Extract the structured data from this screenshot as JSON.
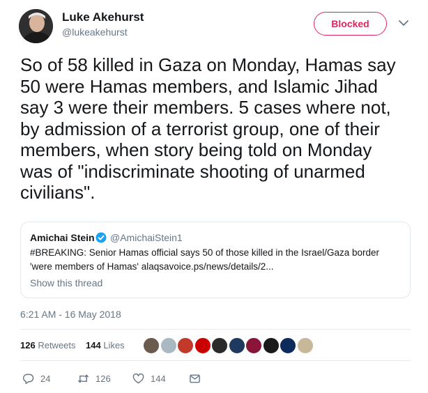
{
  "author": {
    "name": "Luke Akehurst",
    "handle": "@lukeakehurst"
  },
  "header": {
    "blocked_label": "Blocked"
  },
  "tweet": {
    "text": "So of 58 killed in Gaza on Monday, Hamas say\n50 were Hamas members, and Islamic Jihad\nsay 3 were their members. 5 cases where not,\nby admission of a terrorist group, one of their\nmembers, when story being told on Monday\nwas of \"indiscriminate shooting of unarmed\ncivilians\".",
    "timestamp": "6:21 AM - 16 May 2018"
  },
  "quote": {
    "name": "Amichai Stein",
    "handle": "@AmichaiStein1",
    "text": "#BREAKING: Senior Hamas official says 50 of those killed in the Israel/Gaza border\n'were members of Hamas' alaqsavoice.ps/news/details/2...",
    "show_thread": "Show this thread"
  },
  "stats": {
    "retweets_count": "126",
    "retweets_label": "Retweets",
    "likes_count": "144",
    "likes_label": "Likes"
  },
  "liker_avatars": [
    {
      "color": "#6b5a4e"
    },
    {
      "color": "#aab8c2"
    },
    {
      "color": "#c0392b"
    },
    {
      "color": "#cc0000"
    },
    {
      "color": "#2b2b2b"
    },
    {
      "color": "#1f3a5f"
    },
    {
      "color": "#8a1538"
    },
    {
      "color": "#1a1a1a"
    },
    {
      "color": "#0d2a5c"
    },
    {
      "color": "#c8b89a"
    }
  ],
  "actions": {
    "reply_count": "24",
    "retweet_count": "126",
    "like_count": "144"
  },
  "colors": {
    "blocked_accent": "#e0245e",
    "verified": "#1da1f2",
    "muted_text": "#657786"
  }
}
